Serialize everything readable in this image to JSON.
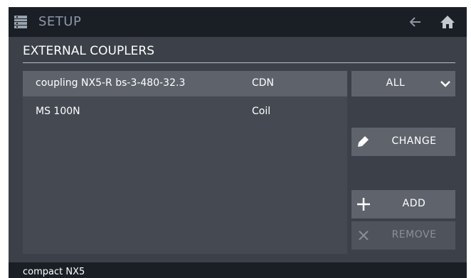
{
  "header": {
    "title": "SETUP",
    "menu_icon": "menu-list-icon",
    "back_icon": "arrow-left-icon",
    "home_icon": "home-icon"
  },
  "section": {
    "title": "EXTERNAL COUPLERS"
  },
  "couplers": [
    {
      "name": "coupling NX5-R bs-3-480-32.3",
      "type": "CDN",
      "selected": true
    },
    {
      "name": "MS 100N",
      "type": "Coil",
      "selected": false
    }
  ],
  "filter": {
    "selected": "ALL"
  },
  "actions": {
    "change_label": "CHANGE",
    "add_label": "ADD",
    "remove_label": "REMOVE"
  },
  "footer": {
    "device": "compact NX5"
  },
  "colors": {
    "background": "#3c4048",
    "bar": "#1a1f26",
    "button": "#5f646c",
    "selected_row": "#5e636b"
  }
}
